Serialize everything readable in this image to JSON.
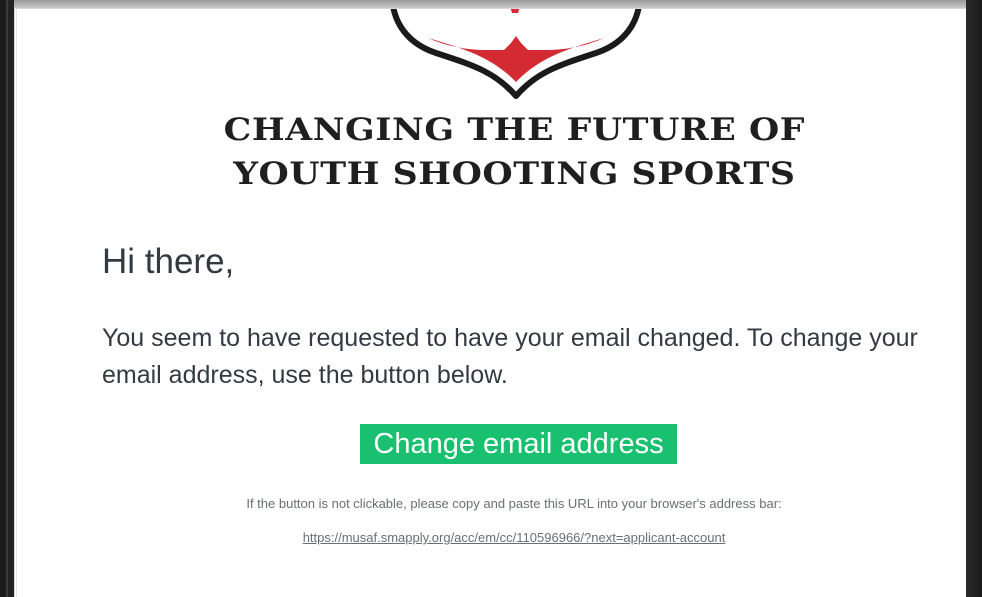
{
  "email": {
    "tagline_line1": "CHANGING THE FUTURE OF",
    "tagline_line2": "YOUTH SHOOTING SPORTS",
    "greeting": "Hi there,",
    "body": "You seem to have requested to have your email changed. To change your email address, use the button below.",
    "button_label": "Change email address",
    "fallback_note": "If the button is not clickable, please copy and paste this URL into your browser's address bar:",
    "fallback_url": "https://musaf.smapply.org/acc/em/cc/110596966/?next=applicant-account"
  },
  "colors": {
    "button_bg": "#18c06f",
    "logo_red": "#d42a33",
    "text": "#333a42"
  },
  "icons": {
    "logo": "shield-logo"
  }
}
